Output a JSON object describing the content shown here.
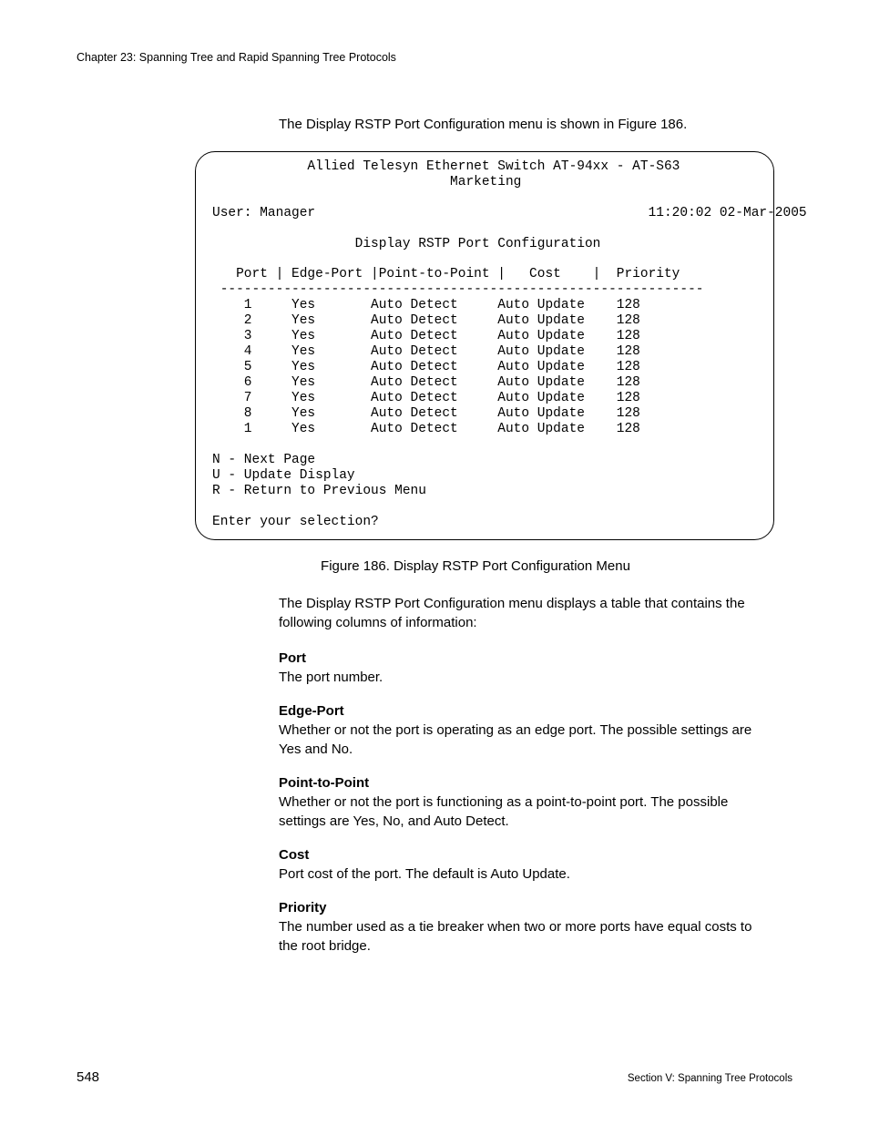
{
  "page_header": "Chapter 23: Spanning Tree and Rapid Spanning Tree Protocols",
  "intro": "The Display RSTP Port Configuration menu is shown in Figure 186.",
  "terminal": {
    "title_line1": "Allied Telesyn Ethernet Switch AT-94xx - AT-S63",
    "title_line2": "Marketing",
    "user_label": "User: Manager",
    "timestamp": "11:20:02 02-Mar-2005",
    "menu_title": "Display RSTP Port Configuration",
    "header_cols": " Port | Edge-Port |Point-to-Point |   Cost    |  Priority",
    "divider": "-------------------------------------------------------------",
    "rows": [
      {
        "port": "1",
        "edge": "Yes",
        "ptp": "Auto Detect",
        "cost": "Auto Update",
        "prio": "128"
      },
      {
        "port": "2",
        "edge": "Yes",
        "ptp": "Auto Detect",
        "cost": "Auto Update",
        "prio": "128"
      },
      {
        "port": "3",
        "edge": "Yes",
        "ptp": "Auto Detect",
        "cost": "Auto Update",
        "prio": "128"
      },
      {
        "port": "4",
        "edge": "Yes",
        "ptp": "Auto Detect",
        "cost": "Auto Update",
        "prio": "128"
      },
      {
        "port": "5",
        "edge": "Yes",
        "ptp": "Auto Detect",
        "cost": "Auto Update",
        "prio": "128"
      },
      {
        "port": "6",
        "edge": "Yes",
        "ptp": "Auto Detect",
        "cost": "Auto Update",
        "prio": "128"
      },
      {
        "port": "7",
        "edge": "Yes",
        "ptp": "Auto Detect",
        "cost": "Auto Update",
        "prio": "128"
      },
      {
        "port": "8",
        "edge": "Yes",
        "ptp": "Auto Detect",
        "cost": "Auto Update",
        "prio": "128"
      },
      {
        "port": "1",
        "edge": "Yes",
        "ptp": "Auto Detect",
        "cost": "Auto Update",
        "prio": "128"
      }
    ],
    "opt_n": "N - Next Page",
    "opt_u": "U - Update Display",
    "opt_r": "R - Return to Previous Menu",
    "prompt": "Enter your selection?"
  },
  "figure_caption": "Figure 186. Display RSTP Port Configuration Menu",
  "body_text": "The Display RSTP Port Configuration menu displays a table that contains the following columns of information:",
  "defs": {
    "port": {
      "term": "Port",
      "desc": "The port number."
    },
    "edge": {
      "term": "Edge-Port",
      "desc": "Whether or not the port is operating as an edge port. The possible settings are Yes and No."
    },
    "ptp": {
      "term": "Point-to-Point",
      "desc": "Whether or not the port is functioning as a point-to-point port. The possible settings are Yes, No, and Auto Detect."
    },
    "cost": {
      "term": "Cost",
      "desc": "Port cost of the port. The default is Auto Update."
    },
    "prio": {
      "term": "Priority",
      "desc": "The number used as a tie breaker when two or more ports have equal costs to the root bridge."
    }
  },
  "footer": {
    "page_number": "548",
    "section": "Section V: Spanning Tree Protocols"
  }
}
